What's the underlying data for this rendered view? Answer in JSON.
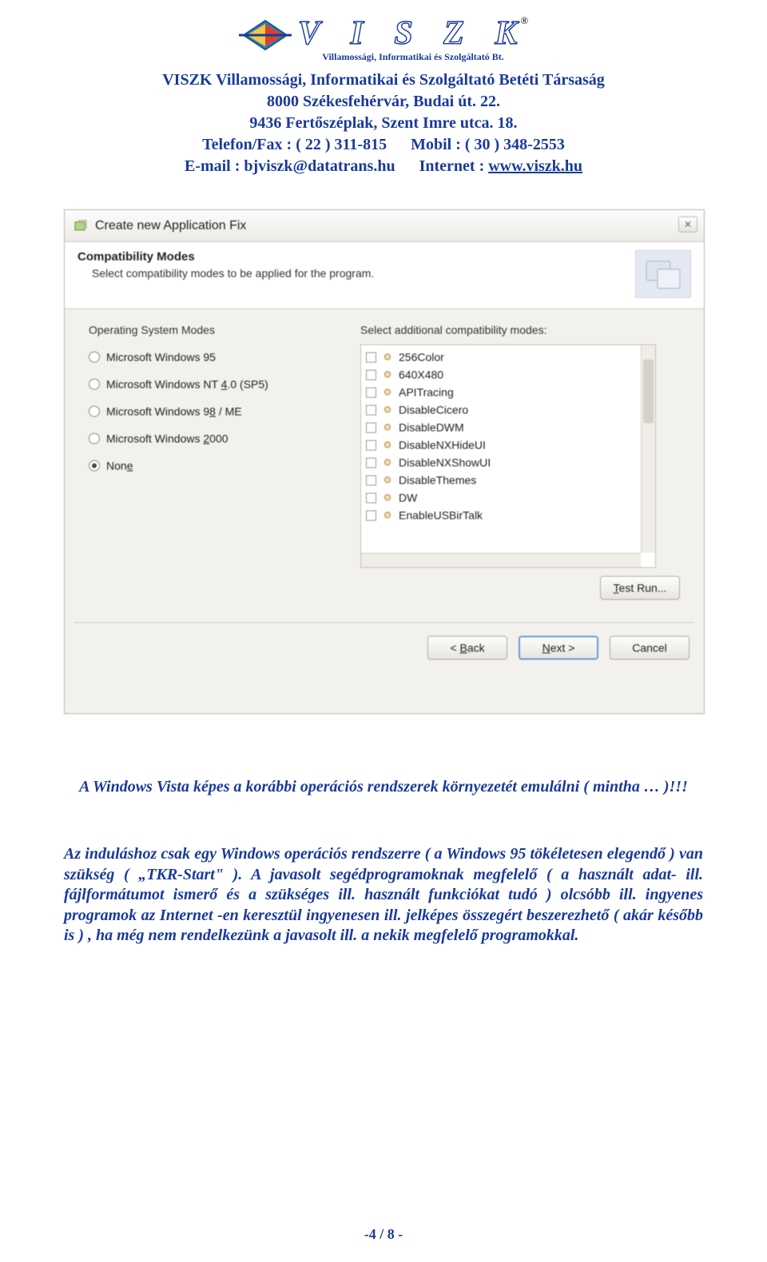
{
  "header": {
    "brand": "V I S Z K",
    "registered": "®",
    "brand_sub": "Villamossági, Informatikai és Szolgáltató Bt.",
    "company_line": "VISZK Villamossági, Informatikai és Szolgáltató Betéti Társaság",
    "address1": "8000 Székesfehérvár, Budai út. 22.",
    "address2": "9436 Fertőszéplak, Szent Imre utca. 18.",
    "phone_label": "Telefon/Fax : ( 22 ) 311-815",
    "mobile_label": "Mobil : ( 30 ) 348-2553",
    "email_label": "E-mail : bjviszk@datatrans.hu",
    "internet_label": "Internet : ",
    "internet_link": "www.viszk.hu"
  },
  "dialog": {
    "title": "Create new Application Fix",
    "head_title": "Compatibility Modes",
    "head_sub": "Select compatibility modes to be applied for the program.",
    "os_label": "Operating System Modes",
    "addl_label": "Select additional compatibility modes:",
    "os_options": {
      "o0": "Microsoft Windows 95",
      "o1_pre": "Microsoft Windows NT ",
      "o1_u": "4",
      "o1_post": ".0 (SP5)",
      "o2_pre": "Microsoft Windows 9",
      "o2_u": "8",
      "o2_post": " / ME",
      "o3_pre": "Microsoft Windows ",
      "o3_u": "2",
      "o3_post": "000",
      "o4_pre": "Non",
      "o4_u": "e"
    },
    "addl_items": [
      "256Color",
      "640X480",
      "APITracing",
      "DisableCicero",
      "DisableDWM",
      "DisableNXHideUI",
      "DisableNXShowUI",
      "DisableThemes",
      "DW",
      "EnableUSBirTalk"
    ],
    "buttons": {
      "test_run_pre": "",
      "test_run_u": "T",
      "test_run_post": "est Run...",
      "back_pre": "< ",
      "back_u": "B",
      "back_post": "ack",
      "next_pre": "",
      "next_u": "N",
      "next_post": "ext >",
      "cancel": "Cancel"
    }
  },
  "body": {
    "line1": "A Windows Vista képes a korábbi operációs rendszerek környezetét emulálni ( mintha … )!!!",
    "para": "Az induláshoz csak egy Windows operációs rendszerre ( a Windows 95 tökéletesen elegendő ) van szükség ( „TKR-Start\" ). A javasolt segédprogramoknak megfelelő ( a használt adat- ill. fájlformátumot ismerő és a szükséges ill.  használt funkciókat tudó ) olcsóbb ill. ingyenes programok az Internet -en keresztül ingyenesen ill. jelképes összegért beszerezhető ( akár később is ) , ha még nem rendelkezünk a javasolt ill. a nekik megfelelő programokkal."
  },
  "page_number": "-4 / 8 -"
}
